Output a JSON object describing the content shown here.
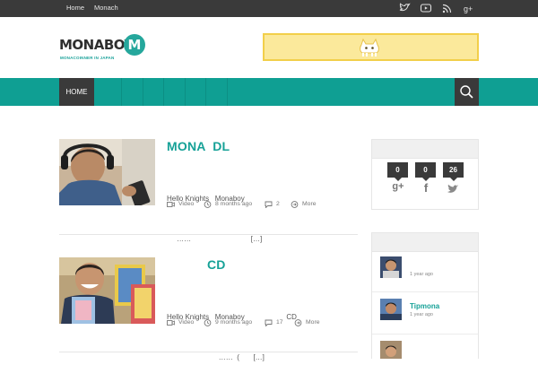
{
  "topbar": {
    "nav": [
      "Home",
      "Monach"
    ],
    "social_icons": [
      "twitter-icon",
      "youtube-icon",
      "rss-icon",
      "googleplus-icon"
    ]
  },
  "header": {
    "logo_text": "MONABOY",
    "logo_tagline": "MONACOINNER IN JAPAN",
    "logo_badge": "M",
    "banner_icon": "mona-mascot-icon"
  },
  "navbar": {
    "home_label": "HOME",
    "search_icon": "search-icon"
  },
  "posts": [
    {
      "title": "MONA  DL",
      "excerpt_line1": "Hello Knights   Monaboy",
      "excerpt_line2": "     ……                              […]",
      "category": "Video",
      "date": "8 months ago",
      "comments": "2",
      "more": "More"
    },
    {
      "title": "           CD",
      "excerpt_line1": "Hello Knights   Monaboy                     CD",
      "excerpt_line2": "                          ……  (       […]",
      "category": "Video",
      "date": "9 months ago",
      "comments": "17",
      "more": "More"
    }
  ],
  "sidebar": {
    "share": [
      {
        "count": "0",
        "icon": "googleplus-icon",
        "glyph": "g+"
      },
      {
        "count": "0",
        "icon": "facebook-icon",
        "glyph": "f"
      },
      {
        "count": "26",
        "icon": "twitter-icon",
        "glyph": "t"
      }
    ],
    "recent": [
      {
        "title": "",
        "date": "1 year ago"
      },
      {
        "title": "Tipmona",
        "date": "1 year ago"
      }
    ]
  },
  "colors": {
    "accent": "#0f9f93",
    "dark": "#3a3a3a",
    "banner": "#fbe99b"
  }
}
